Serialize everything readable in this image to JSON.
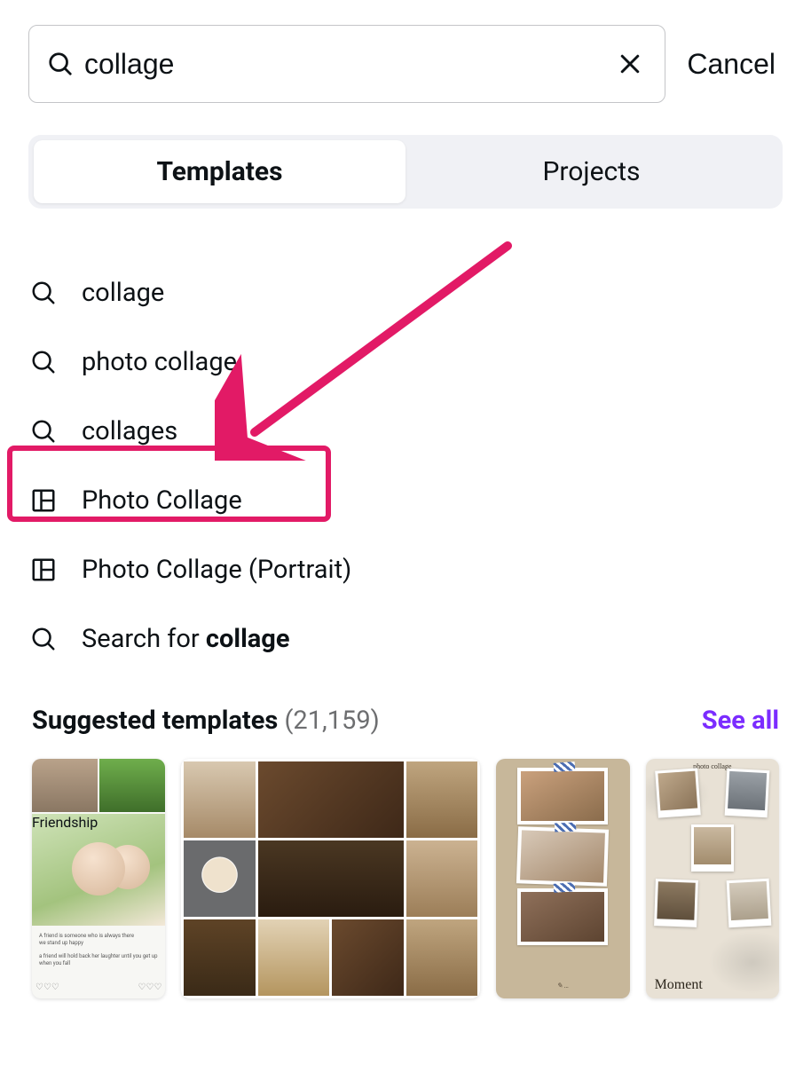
{
  "search": {
    "value": "collage",
    "cancel": "Cancel"
  },
  "tabs": {
    "templates": "Templates",
    "projects": "Projects",
    "active": "templates"
  },
  "suggestions": [
    {
      "icon": "search",
      "label": "collage"
    },
    {
      "icon": "search",
      "label": "photo collage"
    },
    {
      "icon": "search",
      "label": "collages"
    },
    {
      "icon": "collage",
      "label": "Photo Collage"
    },
    {
      "icon": "collage",
      "label": "Photo Collage (Portrait)"
    }
  ],
  "search_for": {
    "prefix": "Search for ",
    "term": "collage"
  },
  "suggested": {
    "title": "Suggested templates",
    "count": "(21,159)",
    "see_all": "See all"
  },
  "thumb_text": {
    "friendship": "Friendship",
    "moment_title": "photo collage",
    "moment": "Moment"
  },
  "annotation": {
    "highlighted": "Photo Collage",
    "color": "#e21a66"
  }
}
